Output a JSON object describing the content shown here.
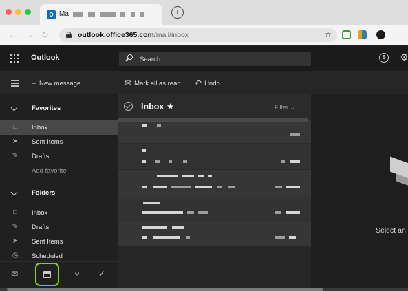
{
  "browser": {
    "tab_title": "Ma",
    "url_host": "outlook.office365.com",
    "url_path": "/mail/inbox",
    "new_tab_symbol": "+"
  },
  "header": {
    "app_name": "Outlook",
    "search_placeholder": "Search"
  },
  "commands": {
    "new_message": "New message",
    "mark_all_read": "Mark all as read",
    "undo": "Undo"
  },
  "sidebar": {
    "favorites_label": "Favorites",
    "favorites": [
      {
        "label": "Inbox",
        "icon": "inbox-icon",
        "selected": true
      },
      {
        "label": "Sent Items",
        "icon": "send-icon"
      },
      {
        "label": "Drafts",
        "icon": "pencil-icon"
      },
      {
        "label": "Add favorite"
      }
    ],
    "folders_label": "Folders",
    "folders": [
      {
        "label": "Inbox",
        "icon": "inbox-icon"
      },
      {
        "label": "Drafts",
        "icon": "pencil-icon"
      },
      {
        "label": "Sent Items",
        "icon": "send-icon"
      },
      {
        "label": "Scheduled",
        "icon": "clock-icon"
      }
    ]
  },
  "message_list": {
    "title": "Inbox",
    "filter_label": "Filter"
  },
  "reading_pane": {
    "empty_text": "Select an"
  },
  "colors": {
    "highlight": "#7ed321",
    "brand": "#0f6cbd"
  }
}
